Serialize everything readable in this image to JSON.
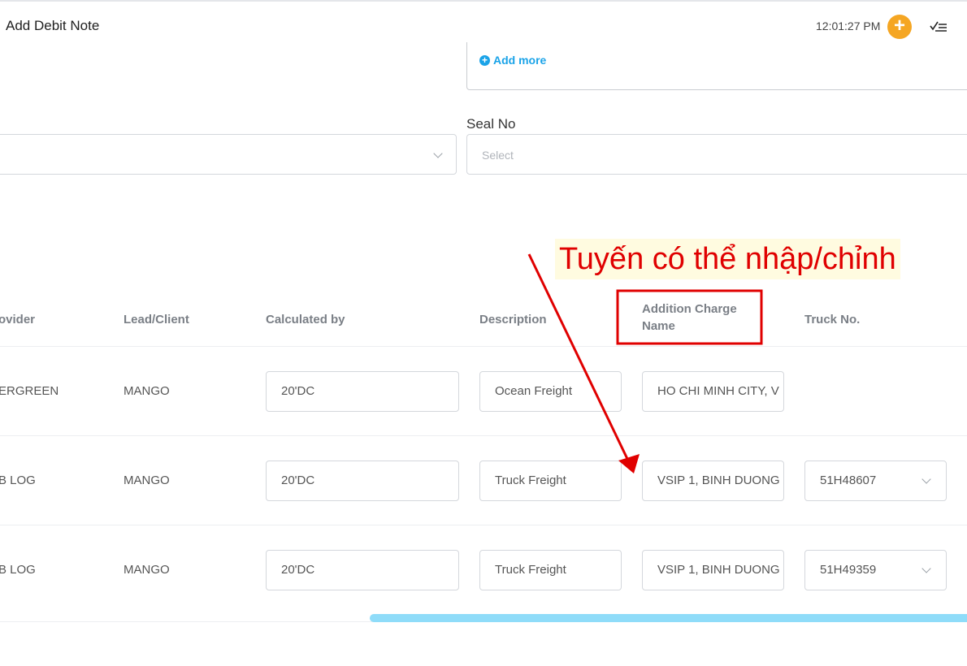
{
  "header": {
    "title": "Add Debit Note",
    "time": "12:01:27 PM",
    "add_icon": "plus-circle-icon",
    "checklist_icon": "checklist-icon",
    "accent_color": "#f5a623"
  },
  "form": {
    "add_more_label": "Add more",
    "seal_label": "Seal No",
    "seal_placeholder": "Select"
  },
  "annotation": {
    "text": "Tuyến có thể nhập/chỉnh",
    "color": "#e00000"
  },
  "table": {
    "columns": [
      "ovider",
      "Lead/Client",
      "Calculated by",
      "Description",
      "Addition Charge Name",
      "Truck No."
    ],
    "rows": [
      {
        "provider": "ERGREEN",
        "client": "MANGO",
        "calculated_by": "20'DC",
        "description": "Ocean Freight",
        "charge_name": "HO CHI MINH CITY, V",
        "truck_no": ""
      },
      {
        "provider": "B LOG",
        "client": "MANGO",
        "calculated_by": "20'DC",
        "description": "Truck Freight",
        "charge_name": "VSIP 1, BINH DUONG",
        "truck_no": "51H48607"
      },
      {
        "provider": "B LOG",
        "client": "MANGO",
        "calculated_by": "20'DC",
        "description": "Truck Freight",
        "charge_name": "VSIP 1, BINH DUONG",
        "truck_no": "51H49359"
      }
    ]
  },
  "scrollbar_color": "#8fdcf9"
}
